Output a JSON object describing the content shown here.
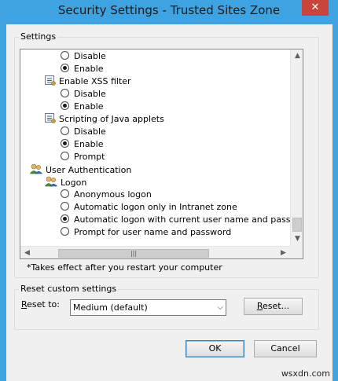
{
  "window": {
    "title": "Security Settings - Trusted Sites Zone",
    "close_glyph": "✕"
  },
  "settings": {
    "group_label": "Settings",
    "rows": [
      {
        "type": "radio",
        "label": "Disable",
        "checked": false
      },
      {
        "type": "radio",
        "label": "Enable",
        "checked": true
      },
      {
        "type": "setting",
        "label": "Enable XSS filter",
        "icon": "setting-icon"
      },
      {
        "type": "radio",
        "label": "Disable",
        "checked": false
      },
      {
        "type": "radio",
        "label": "Enable",
        "checked": true
      },
      {
        "type": "setting",
        "label": "Scripting of Java applets",
        "icon": "setting-icon"
      },
      {
        "type": "radio",
        "label": "Disable",
        "checked": false
      },
      {
        "type": "radio",
        "label": "Enable",
        "checked": true
      },
      {
        "type": "radio",
        "label": "Prompt",
        "checked": false
      },
      {
        "type": "category",
        "label": "User Authentication",
        "icon": "users-icon"
      },
      {
        "type": "subcategory",
        "label": "Logon",
        "icon": "users-icon"
      },
      {
        "type": "radio",
        "label": "Anonymous logon",
        "checked": false
      },
      {
        "type": "radio",
        "label": "Automatic logon only in Intranet zone",
        "checked": false
      },
      {
        "type": "radio",
        "label": "Automatic logon with current user name and password",
        "checked": true
      },
      {
        "type": "radio",
        "label": "Prompt for user name and password",
        "checked": false
      }
    ],
    "note": "*Takes effect after you restart your computer"
  },
  "reset": {
    "group_label": "Reset custom settings",
    "label_prefix": "",
    "label_accel": "R",
    "label_rest": "eset to:",
    "selected": "Medium (default)",
    "button_accel": "R",
    "button_rest": "eset..."
  },
  "buttons": {
    "ok": "OK",
    "cancel": "Cancel"
  },
  "watermark": "wsxdn.com",
  "colors": {
    "title_bar": "#3ea3e0",
    "close_button": "#c7453a"
  }
}
